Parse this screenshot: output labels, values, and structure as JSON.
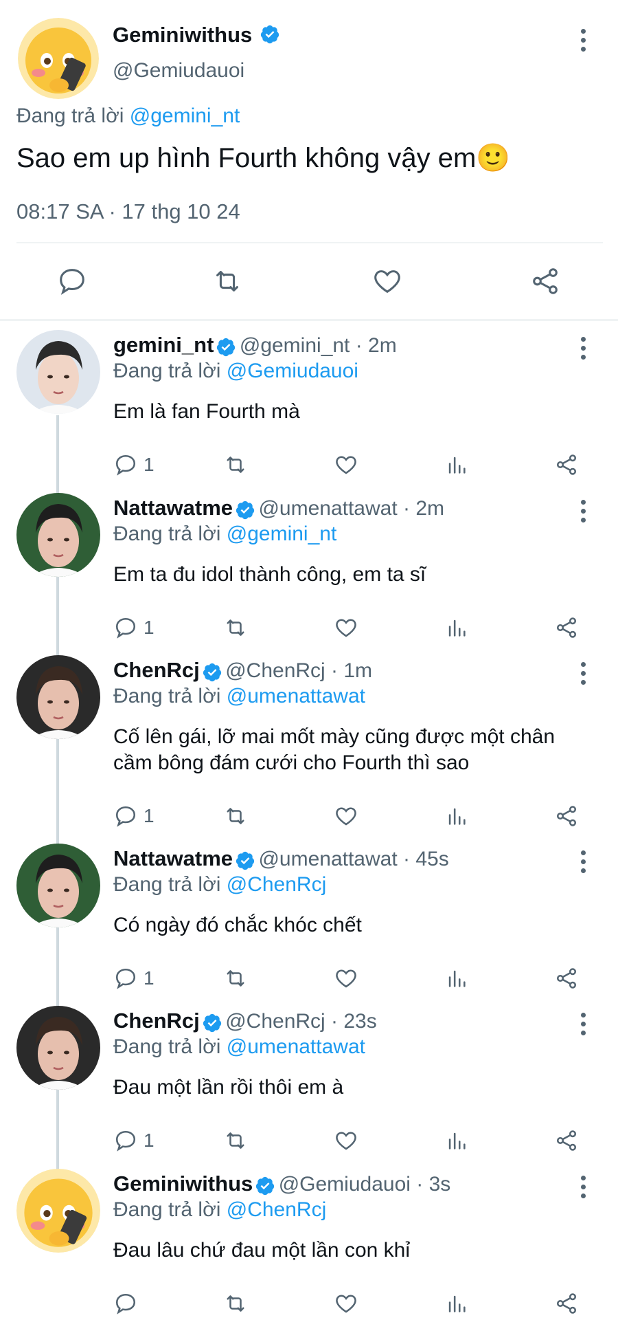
{
  "colors": {
    "accent": "#1d9bf0",
    "text": "#0f1419",
    "muted": "#536471",
    "divider": "#cfd9de"
  },
  "main_tweet": {
    "name": "Geminiwithus",
    "handle": "@Gemiudauoi",
    "replying_prefix": "Đang trả lời",
    "replying_to": "@gemini_nt",
    "text": "Sao em up hình Fourth không vậy em🙂",
    "timestamp": "08:17 SA · 17 thg 10 24"
  },
  "replies": [
    {
      "name": "gemini_nt",
      "handle": "@gemini_nt · 2m",
      "replying_prefix": "Đang trả lời",
      "replying_to": "@Gemiudauoi",
      "text_lines": [
        "Em là fan Fourth mà"
      ],
      "reply_count": "1"
    },
    {
      "name": "Nattawatme",
      "handle": "@umenattawat · 2m",
      "replying_prefix": "Đang trả lời",
      "replying_to": "@gemini_nt",
      "text_lines": [
        "Em ta đu idol thành công, em ta sĩ"
      ],
      "reply_count": "1"
    },
    {
      "name": "ChenRcj",
      "handle": "@ChenRcj · 1m",
      "replying_prefix": "Đang trả lời",
      "replying_to": "@umenattawat",
      "text_lines": [
        "Cố lên gái, lỡ mai mốt mày cũng được một chân",
        "cầm bông đám cưới cho Fourth thì sao"
      ],
      "reply_count": "1"
    },
    {
      "name": "Nattawatme",
      "handle": "@umenattawat · 45s",
      "replying_prefix": "Đang trả lời",
      "replying_to": "@ChenRcj",
      "text_lines": [
        "Có ngày đó chắc khóc chết"
      ],
      "reply_count": "1"
    },
    {
      "name": "ChenRcj",
      "handle": "@ChenRcj · 23s",
      "replying_prefix": "Đang trả lời",
      "replying_to": "@umenattawat",
      "text_lines": [
        "Đau một lần rồi thôi em à"
      ],
      "reply_count": "1"
    },
    {
      "name": "Geminiwithus",
      "handle": "@Gemiudauoi · 3s",
      "replying_prefix": "Đang trả lời",
      "replying_to": "@ChenRcj",
      "text_lines": [
        "Đau lâu chứ đau một lần con khỉ"
      ],
      "reply_count": ""
    }
  ]
}
